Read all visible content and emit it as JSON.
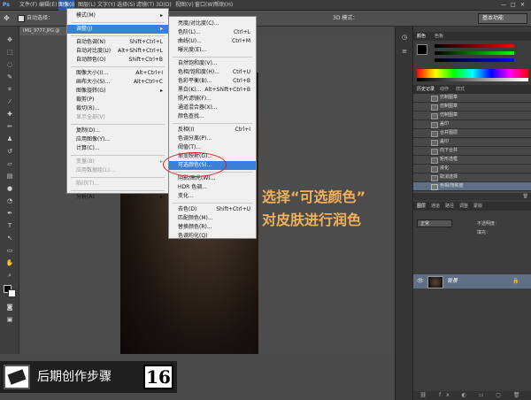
{
  "menubar": {
    "ps_logo": "Ps",
    "items": [
      "文件(F)",
      "编辑(E)",
      "图像(I)",
      "图层(L)",
      "文字(Y)",
      "选择(S)",
      "滤镜(T)",
      "3D(D)",
      "视图(V)",
      "窗口(W)",
      "帮助(H)"
    ]
  },
  "options": {
    "auto_select": "自动选择：",
    "mode3d": "3D 模式：",
    "workspace": "基本功能"
  },
  "document": {
    "tab": "IMG_9777.JPG @"
  },
  "image_menu": [
    {
      "label": "模式(M)",
      "shortcut": "",
      "arrow": true
    },
    {
      "sep": true
    },
    {
      "label": "调整(J)",
      "shortcut": "",
      "arrow": true,
      "hl": true
    },
    {
      "sep": true
    },
    {
      "label": "自动色调(N)",
      "shortcut": "Shift+Ctrl+L"
    },
    {
      "label": "自动对比度(U)",
      "shortcut": "Alt+Shift+Ctrl+L"
    },
    {
      "label": "自动颜色(O)",
      "shortcut": "Shift+Ctrl+B"
    },
    {
      "sep": true
    },
    {
      "label": "图像大小(I)...",
      "shortcut": "Alt+Ctrl+I"
    },
    {
      "label": "画布大小(S)...",
      "shortcut": "Alt+Ctrl+C"
    },
    {
      "label": "图像旋转(G)",
      "shortcut": "",
      "arrow": true
    },
    {
      "label": "裁剪(P)",
      "shortcut": ""
    },
    {
      "label": "裁切(R)...",
      "shortcut": ""
    },
    {
      "label": "显示全部(V)",
      "shortcut": "",
      "dis": true
    },
    {
      "sep": true
    },
    {
      "label": "复制(D)...",
      "shortcut": ""
    },
    {
      "label": "应用图像(Y)...",
      "shortcut": ""
    },
    {
      "label": "计算(C)...",
      "shortcut": ""
    },
    {
      "sep": true
    },
    {
      "label": "变量(B)",
      "shortcut": "",
      "arrow": true,
      "dis": true
    },
    {
      "label": "应用数据组(L)...",
      "shortcut": "",
      "dis": true
    },
    {
      "sep": true
    },
    {
      "label": "陷印(T)...",
      "shortcut": "",
      "dis": true
    },
    {
      "sep": true
    },
    {
      "label": "分析(A)",
      "shortcut": "",
      "arrow": true
    }
  ],
  "adjust_menu": [
    {
      "label": "亮度/对比度(C)...",
      "shortcut": ""
    },
    {
      "label": "色阶(L)...",
      "shortcut": "Ctrl+L"
    },
    {
      "label": "曲线(U)...",
      "shortcut": "Ctrl+M"
    },
    {
      "label": "曝光度(E)...",
      "shortcut": ""
    },
    {
      "sep": true
    },
    {
      "label": "自然饱和度(V)...",
      "shortcut": ""
    },
    {
      "label": "色相/饱和度(H)...",
      "shortcut": "Ctrl+U"
    },
    {
      "label": "色彩平衡(B)...",
      "shortcut": "Ctrl+B"
    },
    {
      "label": "黑白(K)...",
      "shortcut": "Alt+Shift+Ctrl+B"
    },
    {
      "label": "照片滤镜(F)...",
      "shortcut": ""
    },
    {
      "label": "通道混合器(X)...",
      "shortcut": ""
    },
    {
      "label": "颜色查找...",
      "shortcut": ""
    },
    {
      "sep": true
    },
    {
      "label": "反相(I)",
      "shortcut": "Ctrl+I"
    },
    {
      "label": "色调分离(P)...",
      "shortcut": ""
    },
    {
      "label": "阈值(T)...",
      "shortcut": ""
    },
    {
      "label": "渐变映射(G)...",
      "shortcut": ""
    },
    {
      "label": "可选颜色(S)...",
      "shortcut": "",
      "hl": true
    },
    {
      "sep": true
    },
    {
      "label": "阴影/高光(W)...",
      "shortcut": ""
    },
    {
      "label": "HDR 色调...",
      "shortcut": ""
    },
    {
      "label": "变化...",
      "shortcut": ""
    },
    {
      "sep": true
    },
    {
      "label": "去色(D)",
      "shortcut": "Shift+Ctrl+U"
    },
    {
      "label": "匹配颜色(M)...",
      "shortcut": ""
    },
    {
      "label": "替换颜色(R)...",
      "shortcut": ""
    },
    {
      "label": "色调均化(Q)",
      "shortcut": ""
    }
  ],
  "history": {
    "tabs": [
      "历史记录",
      "动作",
      "样式"
    ],
    "items": [
      "仿制图章",
      "仿制图章",
      "仿制图章",
      "盖印",
      "合并图层",
      "盖印",
      "向下合并",
      "矩形选框",
      "液化",
      "取消选择",
      "色相/饱和度"
    ]
  },
  "panels": {
    "color_tabs": [
      "颜色",
      "色板"
    ],
    "layers_tabs": [
      "图层",
      "通道",
      "路径",
      "调整",
      "蒙版"
    ],
    "blend_mode": "正常",
    "opacity_label": "不透明度：",
    "fill_label": "填充：",
    "layer_name": "背景"
  },
  "caption": {
    "line1": "选择“可选颜色”",
    "line2": "对皮肤进行润色"
  },
  "footer": {
    "title": "后期创作步骤",
    "step": "16"
  }
}
